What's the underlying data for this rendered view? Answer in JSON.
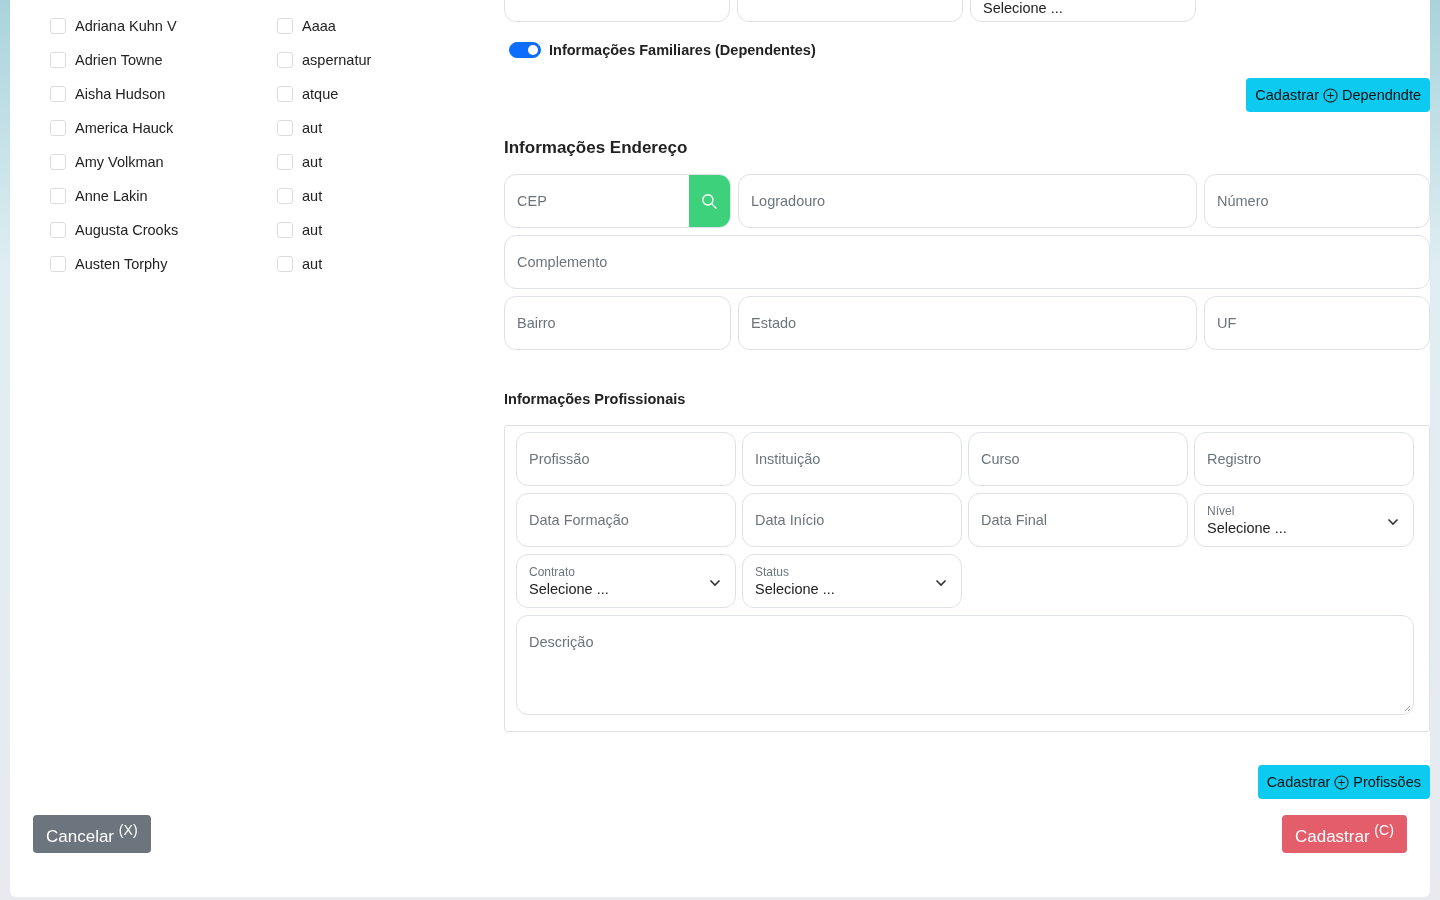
{
  "checklist": {
    "columns": [
      [
        {
          "label": "Adriana Kuhn V",
          "checked": false
        },
        {
          "label": "Adrien Towne",
          "checked": false
        },
        {
          "label": "Aisha Hudson",
          "checked": false
        },
        {
          "label": "America Hauck",
          "checked": false
        },
        {
          "label": "Amy Volkman",
          "checked": false
        },
        {
          "label": "Anne Lakin",
          "checked": false
        },
        {
          "label": "Augusta Crooks",
          "checked": false
        },
        {
          "label": "Austen Torphy",
          "checked": false
        }
      ],
      [
        {
          "label": "Aaaa",
          "checked": false
        },
        {
          "label": "aspernatur",
          "checked": false
        },
        {
          "label": "atque",
          "checked": false
        },
        {
          "label": "aut",
          "checked": false
        },
        {
          "label": "aut",
          "checked": false
        },
        {
          "label": "aut",
          "checked": false
        },
        {
          "label": "aut",
          "checked": false
        },
        {
          "label": "aut",
          "checked": false
        }
      ]
    ]
  },
  "top_fields": [
    {
      "kind": "input"
    },
    {
      "kind": "input"
    },
    {
      "kind": "select",
      "value": "Selecione ..."
    }
  ],
  "dependents_toggle": {
    "label": "Informações Familiares (Dependentes)",
    "on": true
  },
  "add_dependent_button": {
    "label": "Cadastrar",
    "label_after": "Dependndte"
  },
  "address": {
    "title": "Informações Endereço",
    "rows": [
      [
        {
          "kind": "cep",
          "placeholder": "CEP"
        },
        {
          "kind": "input",
          "placeholder": "Logradouro"
        },
        {
          "kind": "input",
          "placeholder": "Número"
        }
      ],
      [
        {
          "kind": "input",
          "placeholder": "Complemento"
        }
      ],
      [
        {
          "kind": "input",
          "placeholder": "Bairro"
        },
        {
          "kind": "input",
          "placeholder": "Estado"
        },
        {
          "kind": "input",
          "placeholder": "UF"
        }
      ]
    ]
  },
  "professional": {
    "title": "Informações Profissionais",
    "fields": [
      {
        "kind": "input",
        "placeholder": "Profissão"
      },
      {
        "kind": "input",
        "placeholder": "Instituição"
      },
      {
        "kind": "input",
        "placeholder": "Curso"
      },
      {
        "kind": "input",
        "placeholder": "Registro"
      },
      {
        "kind": "input",
        "placeholder": "Data Formação"
      },
      {
        "kind": "input",
        "placeholder": "Data Início"
      },
      {
        "kind": "input",
        "placeholder": "Data Final"
      },
      {
        "kind": "select",
        "label": "Nível",
        "value": "Selecione ..."
      },
      {
        "kind": "select",
        "label": "Contrato",
        "value": "Selecione ..."
      },
      {
        "kind": "select",
        "label": "Status",
        "value": "Selecione ..."
      },
      {
        "kind": "textarea",
        "placeholder": "Descrição"
      }
    ]
  },
  "add_profession_button": {
    "label": "Cadastrar",
    "label_after": "Profissões"
  },
  "cancel_button": {
    "label": "Cancelar $^{(X)}$"
  },
  "submit_button": {
    "label": "Cadastrar $^{(C)}$"
  }
}
